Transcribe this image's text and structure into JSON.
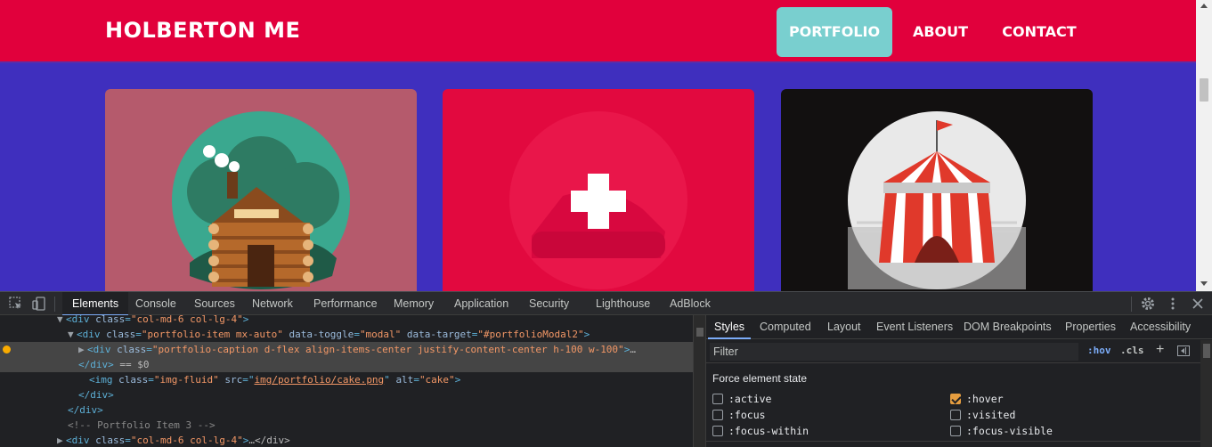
{
  "site": {
    "brand": "HOLBERTON ME",
    "nav": [
      {
        "label": "PORTFOLIO",
        "active": true
      },
      {
        "label": "ABOUT",
        "active": false
      },
      {
        "label": "CONTACT",
        "active": false
      }
    ],
    "colors": {
      "navbar": "#e1003c",
      "background": "#3f2fbe",
      "active_nav": "#79cfcf"
    },
    "portfolio_items": [
      {
        "icon": "log-cabin-icon",
        "background": "#b55a6c"
      },
      {
        "icon": "plus-overlay-icon",
        "background": "#e2093f"
      },
      {
        "icon": "circus-tent-icon",
        "background": "#121010"
      }
    ]
  },
  "devtools": {
    "tabs": [
      "Elements",
      "Console",
      "Sources",
      "Network",
      "Performance",
      "Memory",
      "Application",
      "Security",
      "Lighthouse",
      "AdBlock"
    ],
    "active_tab": "Elements",
    "elements": {
      "l1": {
        "tag": "div",
        "attr": "class",
        "val": "\"col-md-6 col-lg-4\""
      },
      "l2": {
        "tag": "div",
        "a1": "class",
        "v1": "\"portfolio-item mx-auto\"",
        "a2": "data-toggle",
        "v2": "\"modal\"",
        "a3": "data-target",
        "v3": "\"#portfolioModal2\""
      },
      "l3": {
        "tag": "div",
        "attr": "class",
        "val": "\"portfolio-caption d-flex align-items-center justify-content-center h-100 w-100\"",
        "tail": "…"
      },
      "l4": {
        "close": "</div>",
        "suffix": " == $0"
      },
      "l5": {
        "tag": "img",
        "a1": "class",
        "v1": "\"img-fluid\"",
        "a2": "src",
        "v2": "img/portfolio/cake.png",
        "a3": "alt",
        "v3": "\"cake\""
      },
      "l6": {
        "close": "</div>"
      },
      "l7": {
        "close": "</div>"
      },
      "l8": {
        "comment": "<!-- Portfolio Item 3 -->"
      },
      "l9": {
        "tag": "div",
        "attr": "class",
        "val": "\"col-md-6 col-lg-4\"",
        "tail": "…</div>"
      }
    },
    "styles": {
      "tabs": [
        "Styles",
        "Computed",
        "Layout",
        "Event Listeners",
        "DOM Breakpoints",
        "Properties",
        "Accessibility"
      ],
      "active_tab": "Styles",
      "filter_placeholder": "Filter",
      "hov": ":hov",
      "cls": ".cls",
      "plus": "+",
      "force_title": "Force element state",
      "states": [
        {
          "label": ":active",
          "checked": false
        },
        {
          "label": ":hover",
          "checked": true
        },
        {
          "label": ":focus",
          "checked": false
        },
        {
          "label": ":visited",
          "checked": false
        },
        {
          "label": ":focus-within",
          "checked": false
        },
        {
          "label": ":focus-visible",
          "checked": false
        }
      ]
    }
  }
}
